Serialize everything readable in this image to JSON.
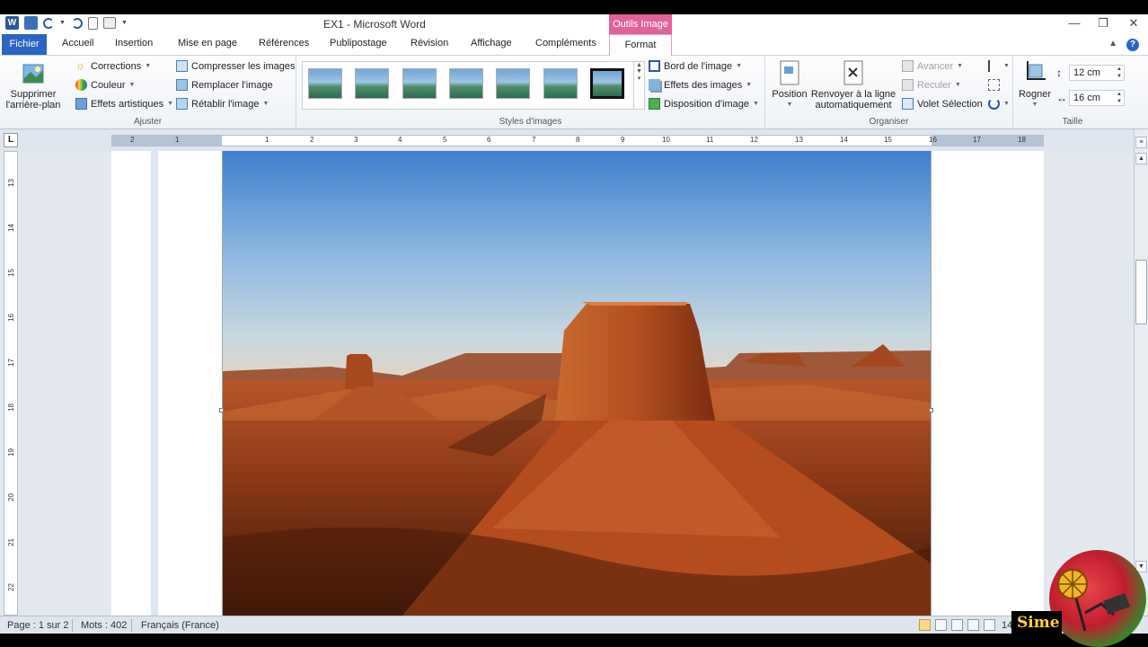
{
  "window": {
    "title": "EX1 - Microsoft Word",
    "contextual_tab_title": "Outils Image",
    "minimize": "—",
    "restore": "❐",
    "close": "✕"
  },
  "tabs": {
    "file": "Fichier",
    "items": [
      "Accueil",
      "Insertion",
      "Mise en page",
      "Références",
      "Publipostage",
      "Révision",
      "Affichage",
      "Compléments"
    ],
    "format": "Format"
  },
  "ribbon": {
    "ajuster": {
      "label": "Ajuster",
      "remove_bg": [
        "Supprimer",
        "l'arrière-plan"
      ],
      "corrections": "Corrections",
      "couleur": "Couleur",
      "effets_artistiques": "Effets artistiques",
      "compresser": "Compresser les images",
      "remplacer": "Remplacer l'image",
      "retablir": "Rétablir l'image"
    },
    "styles": {
      "label": "Styles d'images",
      "bord": "Bord de l'image",
      "effets": "Effets des images",
      "disposition": "Disposition d'image"
    },
    "organiser": {
      "label": "Organiser",
      "position": "Position",
      "renvoyer": [
        "Renvoyer à la ligne",
        "automatiquement"
      ],
      "avancer": "Avancer",
      "reculer": "Reculer",
      "volet": "Volet Sélection"
    },
    "taille": {
      "label": "Taille",
      "rogner": "Rogner",
      "height": "12 cm",
      "width": "16 cm"
    }
  },
  "ruler": {
    "h_numbers": [
      "2",
      "1",
      "1",
      "2",
      "3",
      "4",
      "5",
      "6",
      "7",
      "8",
      "9",
      "10",
      "11",
      "12",
      "13",
      "14",
      "15",
      "16",
      "17",
      "18"
    ],
    "v_numbers": [
      "13",
      "14",
      "15",
      "16",
      "17",
      "18",
      "19",
      "20",
      "21",
      "22"
    ]
  },
  "status": {
    "page": "Page : 1 sur 2",
    "words": "Mots : 402",
    "language": "Français (France)",
    "zoom": "14"
  },
  "watermark": {
    "text": "Sime"
  },
  "colors": {
    "file_tab": "#2b65c4",
    "contextual": "#e0629a"
  }
}
